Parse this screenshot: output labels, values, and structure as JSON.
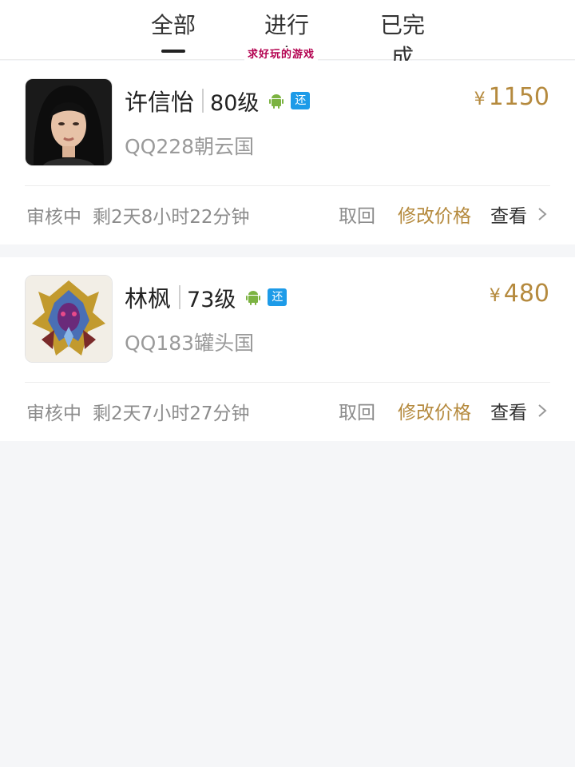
{
  "tabs": [
    {
      "label": "全部",
      "active": true
    },
    {
      "label": "进行中"
    },
    {
      "label": "已完成"
    }
  ],
  "watermark": "求好玩的游戏",
  "colors": {
    "accent_price": "#b58a3e",
    "android_green": "#7cb342",
    "badge_blue": "#1d9be8"
  },
  "orders": [
    {
      "name": "许信怡",
      "level": "80级",
      "platform_icon": "android-icon",
      "badge": "还",
      "server": "QQ228朝云国",
      "currency": "¥",
      "price": "1150",
      "status": "审核中",
      "time_left": "剩2天8小时22分钟",
      "actions": {
        "withdraw": "取回",
        "edit": "修改价格",
        "view": "查看"
      }
    },
    {
      "name": "林枫",
      "level": "73级",
      "platform_icon": "android-icon",
      "badge": "还",
      "server": "QQ183罐头国",
      "currency": "¥",
      "price": "480",
      "status": "审核中",
      "time_left": "剩2天7小时27分钟",
      "actions": {
        "withdraw": "取回",
        "edit": "修改价格",
        "view": "查看"
      }
    }
  ]
}
